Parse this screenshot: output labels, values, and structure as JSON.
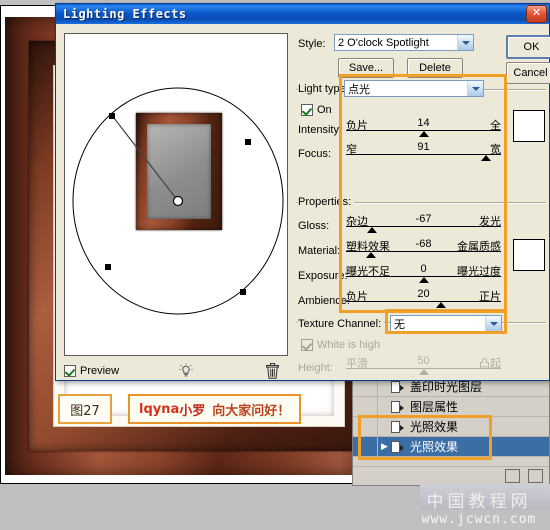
{
  "background": {
    "figure_label": "图27",
    "greeting_prefix": "lqyna",
    "greeting_name": "小罗",
    "greeting_text": "向大家问好！"
  },
  "watermark": {
    "site_name": "中国教程网",
    "url": "www.jcwcn.com"
  },
  "history_palette": {
    "items": [
      {
        "label": "盖印时光图层",
        "selected": false
      },
      {
        "label": "图层属性",
        "selected": false
      },
      {
        "label": "光照效果",
        "selected": false
      },
      {
        "label": "光照效果",
        "selected": true
      }
    ]
  },
  "dialog": {
    "title": "Lighting Effects",
    "close_label": "✕",
    "style": {
      "label": "Style:",
      "value": "2 O'clock Spotlight",
      "save_button": "Save...",
      "delete_button": "Delete"
    },
    "actions": {
      "ok": "OK",
      "cancel": "Cancel"
    },
    "light_type": {
      "label": "Light type:",
      "value": "点光",
      "on_label": "On",
      "on_checked": true
    },
    "intensity": {
      "label": "Intensity:",
      "min_label": "负片",
      "max_label": "全",
      "value": "14",
      "thumb_pct": 50
    },
    "focus": {
      "label": "Focus:",
      "min_label": "窄",
      "max_label": "宽",
      "value": "91",
      "thumb_pct": 90
    },
    "properties_label": "Properties:",
    "gloss": {
      "label": "Gloss:",
      "min_label": "杂边",
      "max_label": "发光",
      "value": "-67",
      "thumb_pct": 17
    },
    "material": {
      "label": "Material:",
      "min_label": "塑料效果",
      "max_label": "金属质感",
      "value": "-68",
      "thumb_pct": 16
    },
    "exposure": {
      "label": "Exposure:",
      "min_label": "曝光不足",
      "max_label": "曝光过度",
      "value": "0",
      "thumb_pct": 50
    },
    "ambience": {
      "label": "Ambience:",
      "min_label": "负片",
      "max_label": "正片",
      "value": "20",
      "thumb_pct": 61
    },
    "texture": {
      "label": "Texture Channel:",
      "value": "无",
      "white_is_high_label": "White is high",
      "white_is_high_checked": true,
      "height_label": "Height:",
      "height_min_label": "平滑",
      "height_max_label": "凸起",
      "height_value": "50",
      "height_thumb_pct": 50
    },
    "preview": {
      "label": "Preview",
      "checked": true,
      "bulb_icon": "light-bulb-icon",
      "trash_icon": "trash-icon"
    }
  },
  "colors": {
    "accent_highlight": "#f0a028",
    "titlebar_blue": "#0a56c8",
    "dialog_face": "#ece9d8",
    "selection_blue": "#3a6ea5",
    "swatch_light": "#ffffff"
  }
}
